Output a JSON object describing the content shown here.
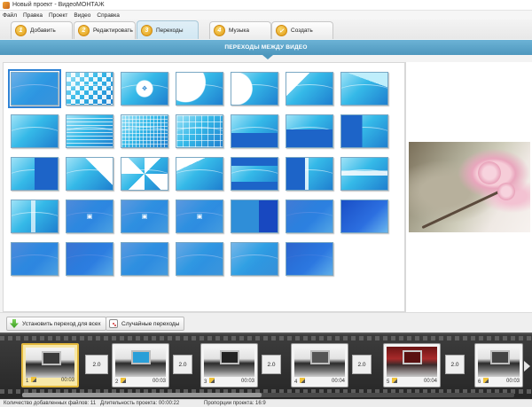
{
  "window": {
    "title": "Новый проект - ВидеоМОНТАЖ"
  },
  "menu": [
    "Файл",
    "Правка",
    "Проект",
    "Видео",
    "Справка"
  ],
  "tabs": [
    {
      "num": "1",
      "label": "Добавить",
      "active": false
    },
    {
      "num": "2",
      "label": "Редактировать",
      "active": false
    },
    {
      "num": "3",
      "label": "Переходы",
      "active": true
    },
    {
      "num": "4",
      "label": "Музыка",
      "active": false
    },
    {
      "num": "✓",
      "label": "Создать",
      "active": false
    }
  ],
  "section": {
    "title": "ПЕРЕХОДЫ МЕЖДУ ВИДЕО"
  },
  "actions": {
    "apply_all": "Установить переход для всех",
    "random": "Случайные переходы"
  },
  "timeline": {
    "clips": [
      {
        "index": "1",
        "duration": "00:03"
      },
      {
        "index": "2",
        "duration": "00:03"
      },
      {
        "index": "3",
        "duration": "00:03"
      },
      {
        "index": "4",
        "duration": "00:04"
      },
      {
        "index": "5",
        "duration": "00:04"
      },
      {
        "index": "6",
        "duration": "00:03"
      }
    ],
    "transitions": [
      "2.0",
      "2.0",
      "2.0",
      "2.0",
      "2.0"
    ]
  },
  "status": {
    "files": "Количество добавленных файлов: 11",
    "duration": "Длительность проекта: 00:00:22",
    "ratio": "Пропорции проекта: 16:9"
  }
}
